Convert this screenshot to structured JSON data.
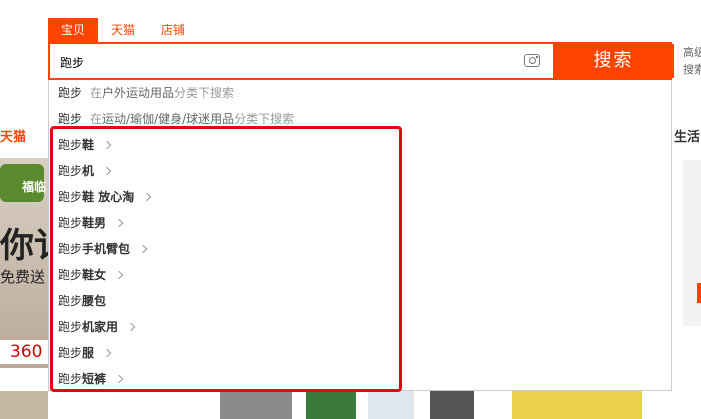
{
  "tabs": [
    {
      "label": "宝贝",
      "active": true
    },
    {
      "label": "天猫",
      "active": false
    },
    {
      "label": "店铺",
      "active": false
    }
  ],
  "search": {
    "value": "跑步",
    "button_label": "搜索",
    "camera_icon": "camera-icon"
  },
  "side": {
    "line1": "高级",
    "line2": "搜索"
  },
  "category_suggestions": [
    {
      "query": "跑步",
      "prefix": "在",
      "category": "户外运动用品",
      "suffix": "分类下搜索"
    },
    {
      "query": "跑步",
      "prefix": "在",
      "category": "运动/瑜伽/健身/球迷用品",
      "suffix": "分类下搜索"
    }
  ],
  "suggestions": [
    {
      "base": "跑步",
      "extra": "鞋",
      "has_arrow": true
    },
    {
      "base": "跑步",
      "extra": "机",
      "has_arrow": true
    },
    {
      "base": "跑步",
      "extra": "鞋 放心淘",
      "has_arrow": true
    },
    {
      "base": "跑步",
      "extra": "鞋男",
      "has_arrow": true
    },
    {
      "base": "跑步",
      "extra": "手机臂包",
      "has_arrow": true
    },
    {
      "base": "跑步",
      "extra": "鞋女",
      "has_arrow": true
    },
    {
      "base": "跑步",
      "extra": "腰包",
      "has_arrow": false
    },
    {
      "base": "跑步",
      "extra": "机家用",
      "has_arrow": true
    },
    {
      "base": "跑步",
      "extra": "服",
      "has_arrow": true
    },
    {
      "base": "跑步",
      "extra": "短裤",
      "has_arrow": true
    }
  ],
  "background": {
    "tmall_label": "天猫",
    "life_label": "生活",
    "banner_logo": "福临",
    "banner_big": "你讠",
    "banner_free": "免费送",
    "banner_price": "360"
  },
  "colors": {
    "accent": "#ff4400",
    "highlight_box": "#e30613"
  }
}
